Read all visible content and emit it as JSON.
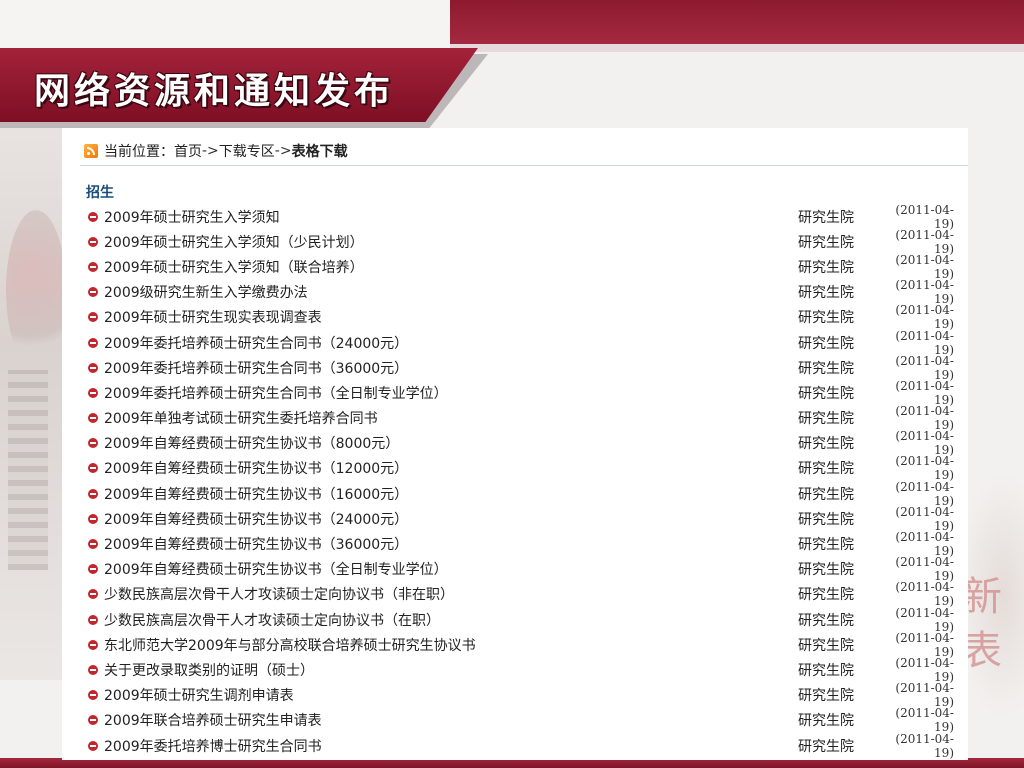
{
  "banner": {
    "title": "网络资源和通知发布"
  },
  "breadcrumb": {
    "prefix": "当前位置：",
    "items": [
      "首页",
      "下载专区",
      "表格下载"
    ],
    "separator": "->"
  },
  "section": {
    "title": "招生"
  },
  "rows": [
    {
      "name": "2009年硕士研究生入学须知",
      "dept": "研究生院",
      "date": "(2011-04-19)"
    },
    {
      "name": "2009年硕士研究生入学须知（少民计划）",
      "dept": "研究生院",
      "date": "(2011-04-19)"
    },
    {
      "name": "2009年硕士研究生入学须知（联合培养）",
      "dept": "研究生院",
      "date": "(2011-04-19)"
    },
    {
      "name": "2009级研究生新生入学缴费办法",
      "dept": "研究生院",
      "date": "(2011-04-19)"
    },
    {
      "name": "2009年硕士研究生现实表现调查表",
      "dept": "研究生院",
      "date": "(2011-04-19)"
    },
    {
      "name": "2009年委托培养硕士研究生合同书（24000元）",
      "dept": "研究生院",
      "date": "(2011-04-19)"
    },
    {
      "name": "2009年委托培养硕士研究生合同书（36000元）",
      "dept": "研究生院",
      "date": "(2011-04-19)"
    },
    {
      "name": "2009年委托培养硕士研究生合同书（全日制专业学位）",
      "dept": "研究生院",
      "date": "(2011-04-19)"
    },
    {
      "name": "2009年单独考试硕士研究生委托培养合同书",
      "dept": "研究生院",
      "date": "(2011-04-19)"
    },
    {
      "name": "2009年自筹经费硕士研究生协议书（8000元）",
      "dept": "研究生院",
      "date": "(2011-04-19)"
    },
    {
      "name": "2009年自筹经费硕士研究生协议书（12000元）",
      "dept": "研究生院",
      "date": "(2011-04-19)"
    },
    {
      "name": "2009年自筹经费硕士研究生协议书（16000元）",
      "dept": "研究生院",
      "date": "(2011-04-19)"
    },
    {
      "name": "2009年自筹经费硕士研究生协议书（24000元）",
      "dept": "研究生院",
      "date": "(2011-04-19)"
    },
    {
      "name": "2009年自筹经费硕士研究生协议书（36000元）",
      "dept": "研究生院",
      "date": "(2011-04-19)"
    },
    {
      "name": "2009年自筹经费硕士研究生协议书（全日制专业学位）",
      "dept": "研究生院",
      "date": "(2011-04-19)"
    },
    {
      "name": "少数民族高层次骨干人才攻读硕士定向协议书（非在职）",
      "dept": "研究生院",
      "date": "(2011-04-19)"
    },
    {
      "name": "少数民族高层次骨干人才攻读硕士定向协议书（在职）",
      "dept": "研究生院",
      "date": "(2011-04-19)"
    },
    {
      "name": "东北师范大学2009年与部分高校联合培养硕士研究生协议书",
      "dept": "研究生院",
      "date": "(2011-04-19)"
    },
    {
      "name": "关于更改录取类别的证明（硕士）",
      "dept": "研究生院",
      "date": "(2011-04-19)"
    },
    {
      "name": "2009年硕士研究生调剂申请表",
      "dept": "研究生院",
      "date": "(2011-04-19)"
    },
    {
      "name": "2009年联合培养硕士研究生申请表",
      "dept": "研究生院",
      "date": "(2011-04-19)"
    },
    {
      "name": "2009年委托培养博士研究生合同书",
      "dept": "研究生院",
      "date": "(2011-04-19)"
    }
  ],
  "background_text": "新 表",
  "colors": {
    "brand_red": "#8e1a30",
    "section_blue": "#1a4d7c",
    "bullet_red": "#c0272d"
  }
}
